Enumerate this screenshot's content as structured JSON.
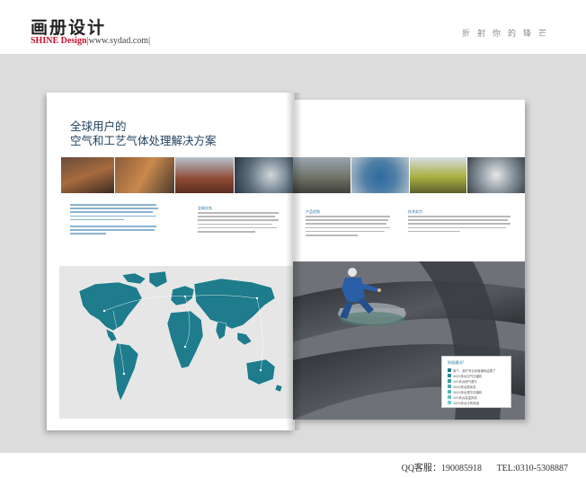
{
  "header": {
    "title": "画册设计",
    "brand_red": "SHINE Design",
    "brand_rest": "|www.sydad.com|",
    "slogan": "折射你的锋芒"
  },
  "brochure": {
    "left_title_line1": "全球用户的",
    "left_title_line2": "空气和工艺气体处理解决方案",
    "right_col1_heading": "产品优势",
    "right_col2_heading": "技术实力",
    "left_col2_heading": "全球业务",
    "legend_title": "阶段通讯?",
    "legend_items": [
      "某个，我们专业序营通商监看了",
      "4000多台空气压缩机",
      "200多台燃气透平",
      "3000多台鼓风机",
      "3000多台透平压缩机",
      "100多台高温风机",
      "1000多台冷风机组"
    ]
  },
  "footer": {
    "qq": "QQ客服：190085918",
    "tel": "TEL:0310-5308887"
  },
  "colors": {
    "brand_red": "#c8102e",
    "title_blue": "#1f3f5a",
    "map_teal": "#1e7c8c",
    "accent_blue": "#1a6aa0"
  }
}
